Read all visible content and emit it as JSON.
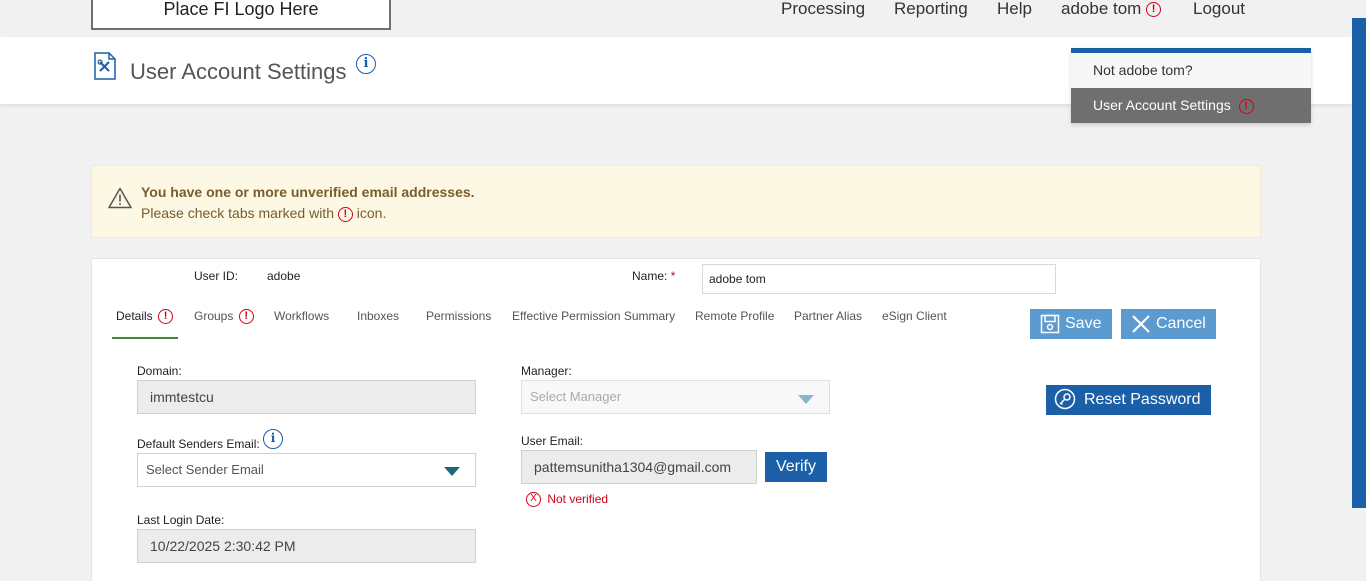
{
  "topbar": {
    "logo_text": "Place FI Logo Here",
    "nav": [
      "Processing",
      "Reporting",
      "Help"
    ],
    "user_name": "adobe tom",
    "logout": "Logout",
    "warn_glyph": "!"
  },
  "header": {
    "title": "User Account Settings",
    "info_glyph": "i"
  },
  "user_menu": {
    "item1": "Not adobe tom?",
    "item2": "User Account Settings",
    "warn_glyph": "!"
  },
  "banner": {
    "line1": "You have one or more unverified email addresses.",
    "line2_before": "Please check tabs marked with",
    "line2_after": "icon.",
    "warn_glyph": "!"
  },
  "form": {
    "user_id_label": "User ID:",
    "user_id_value": "adobe",
    "name_label": "Name:",
    "name_required": "*",
    "name_value": "adobe tom",
    "tabs": [
      {
        "label": "Details",
        "warn": true,
        "active": true
      },
      {
        "label": "Groups",
        "warn": true,
        "active": false
      },
      {
        "label": "Workflows",
        "warn": false,
        "active": false
      },
      {
        "label": "Inboxes",
        "warn": false,
        "active": false
      },
      {
        "label": "Permissions",
        "warn": false,
        "active": false
      },
      {
        "label": "Effective Permission Summary",
        "warn": false,
        "active": false
      },
      {
        "label": "Remote Profile",
        "warn": false,
        "active": false
      },
      {
        "label": "Partner Alias",
        "warn": false,
        "active": false
      },
      {
        "label": "eSign Client",
        "warn": false,
        "active": false
      }
    ],
    "save_label": "Save",
    "cancel_label": "Cancel",
    "reset_password_label": "Reset Password",
    "domain_label": "Domain:",
    "domain_value": "immtestcu",
    "manager_label": "Manager:",
    "manager_placeholder": "Select Manager",
    "sender_email_label": "Default Senders Email:",
    "sender_email_placeholder": "Select Sender Email",
    "user_email_label": "User Email:",
    "user_email_value": "pattemsunitha1304@gmail.com",
    "verify_label": "Verify",
    "not_verified_glyph": "X",
    "not_verified_text": "Not verified",
    "last_login_label": "Last Login Date:",
    "last_login_value": "10/22/2025 2:30:42 PM"
  },
  "colors": {
    "primary": "#1a5fa8",
    "light_blue": "#5b9bd0",
    "warning_red": "#d0021b",
    "banner_bg": "#fcf8e3",
    "tab_active_underline": "#3c8a3c"
  }
}
